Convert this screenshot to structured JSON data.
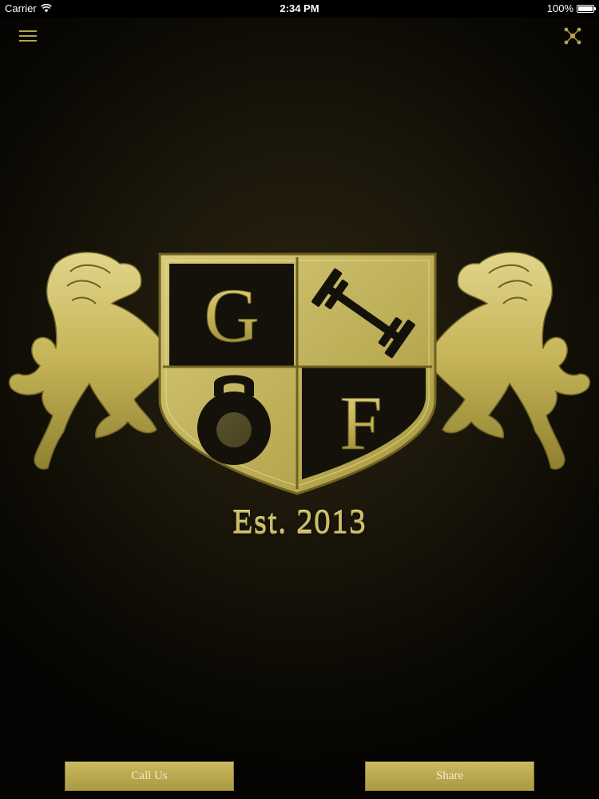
{
  "status_bar": {
    "carrier": "Carrier",
    "time": "2:34 PM",
    "battery": "100%"
  },
  "nav": {
    "menu_icon": "hamburger-menu-icon",
    "share_icon": "share-network-icon"
  },
  "logo": {
    "letters": [
      "G",
      "F"
    ],
    "established": "Est. 2013"
  },
  "actions": {
    "call_label": "Call Us",
    "share_label": "Share"
  },
  "colors": {
    "gold": "#c9b95e",
    "gold_dark": "#8a7d35",
    "background": "#1a160a"
  }
}
